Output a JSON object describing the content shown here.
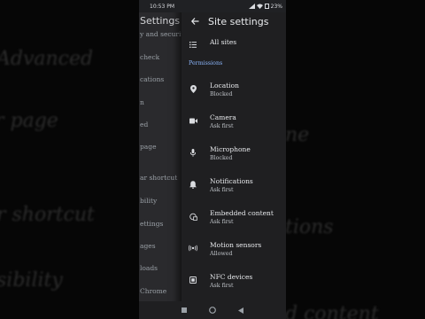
{
  "background_words": [
    {
      "text": "Advanced"
    },
    {
      "text": "r page"
    },
    {
      "text": "ne"
    },
    {
      "text": "r shortcut"
    },
    {
      "text": "tions"
    },
    {
      "text": "sibility"
    },
    {
      "text": "d content"
    }
  ],
  "status_bar": {
    "time": "10:53 PM",
    "battery": "23%"
  },
  "underlying_page": {
    "title": "Settings",
    "items": [
      "y and security",
      "check",
      "cations",
      "n",
      "ed",
      "page",
      "ar shortcut",
      "bility",
      "ettings",
      "ages",
      "loads",
      "Chrome"
    ]
  },
  "site_settings": {
    "title": "Site settings",
    "all_sites": "All sites",
    "section_label": "Permissions",
    "permissions": [
      {
        "label": "Location",
        "status": "Blocked",
        "icon": "location-pin-icon"
      },
      {
        "label": "Camera",
        "status": "Ask first",
        "icon": "camera-icon"
      },
      {
        "label": "Microphone",
        "status": "Blocked",
        "icon": "microphone-icon"
      },
      {
        "label": "Notifications",
        "status": "Ask first",
        "icon": "bell-icon"
      },
      {
        "label": "Embedded content",
        "status": "Ask first",
        "icon": "embedded-content-icon"
      },
      {
        "label": "Motion sensors",
        "status": "Allowed",
        "icon": "motion-sensor-icon"
      },
      {
        "label": "NFC devices",
        "status": "Ask first",
        "icon": "nfc-icon"
      }
    ]
  },
  "colors": {
    "accent": "#8ab4f8",
    "panel": "#1f1f21",
    "text": "#e8eaed"
  }
}
